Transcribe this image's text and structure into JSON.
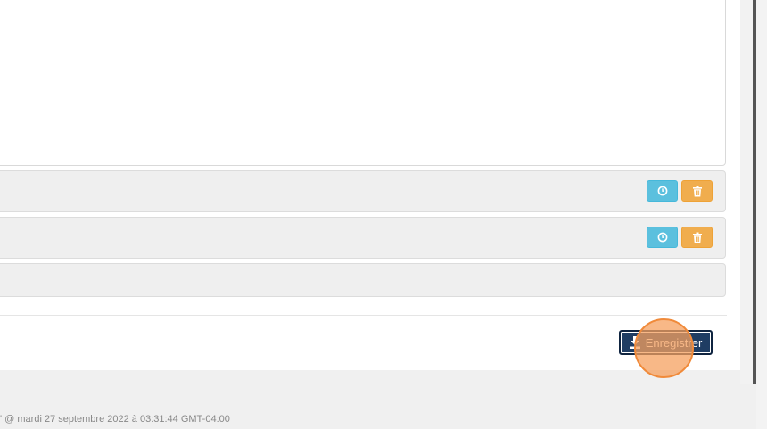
{
  "rows": [
    {
      "clock_icon": "clock-icon",
      "trash_icon": "trash-icon"
    },
    {
      "clock_icon": "clock-icon",
      "trash_icon": "trash-icon"
    },
    {}
  ],
  "actions": {
    "save_label": "Enregistrer",
    "save_icon": "download-icon"
  },
  "footer": {
    "timestamp_text": "' @ mardi 27 septembre 2022 à 03:31:44 GMT-04:00"
  },
  "colors": {
    "info_button": "#5bc0de",
    "warning_button": "#f0ad4e",
    "primary_button": "#1f3d63",
    "click_marker": "#f08a3a"
  }
}
